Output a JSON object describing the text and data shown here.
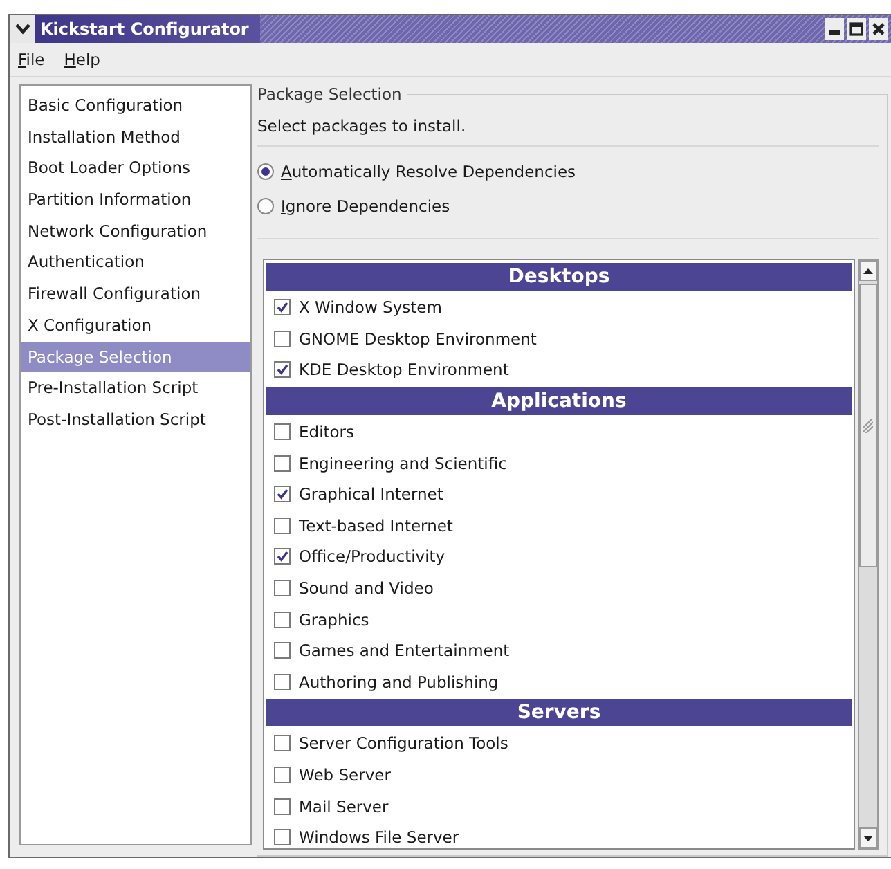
{
  "window": {
    "title": "Kickstart Configurator"
  },
  "menu": [
    "File",
    "Help"
  ],
  "sidebar": {
    "items": [
      {
        "label": "Basic Configuration",
        "selected": false
      },
      {
        "label": "Installation Method",
        "selected": false
      },
      {
        "label": "Boot Loader Options",
        "selected": false
      },
      {
        "label": "Partition Information",
        "selected": false
      },
      {
        "label": "Network Configuration",
        "selected": false
      },
      {
        "label": "Authentication",
        "selected": false
      },
      {
        "label": "Firewall Configuration",
        "selected": false
      },
      {
        "label": "X Configuration",
        "selected": false
      },
      {
        "label": "Package Selection",
        "selected": true
      },
      {
        "label": "Pre-Installation Script",
        "selected": false
      },
      {
        "label": "Post-Installation Script",
        "selected": false
      }
    ]
  },
  "package_selection": {
    "title": "Package Selection",
    "instruction": "Select packages to install.",
    "dependency_options": [
      {
        "label": "Automatically Resolve Dependencies",
        "selected": true
      },
      {
        "label": "Ignore Dependencies",
        "selected": false
      }
    ],
    "groups": [
      {
        "title": "Desktops",
        "packages": [
          {
            "label": "X Window System",
            "checked": true
          },
          {
            "label": "GNOME Desktop Environment",
            "checked": false
          },
          {
            "label": "KDE Desktop Environment",
            "checked": true
          }
        ]
      },
      {
        "title": "Applications",
        "packages": [
          {
            "label": "Editors",
            "checked": false
          },
          {
            "label": "Engineering and Scientific",
            "checked": false
          },
          {
            "label": "Graphical Internet",
            "checked": true
          },
          {
            "label": "Text-based Internet",
            "checked": false
          },
          {
            "label": "Office/Productivity",
            "checked": true
          },
          {
            "label": "Sound and Video",
            "checked": false
          },
          {
            "label": "Graphics",
            "checked": false
          },
          {
            "label": "Games and Entertainment",
            "checked": false
          },
          {
            "label": "Authoring and Publishing",
            "checked": false
          }
        ]
      },
      {
        "title": "Servers",
        "packages": [
          {
            "label": "Server Configuration Tools",
            "checked": false
          },
          {
            "label": "Web Server",
            "checked": false
          },
          {
            "label": "Mail Server",
            "checked": false
          },
          {
            "label": "Windows File Server",
            "checked": false
          }
        ]
      }
    ]
  }
}
